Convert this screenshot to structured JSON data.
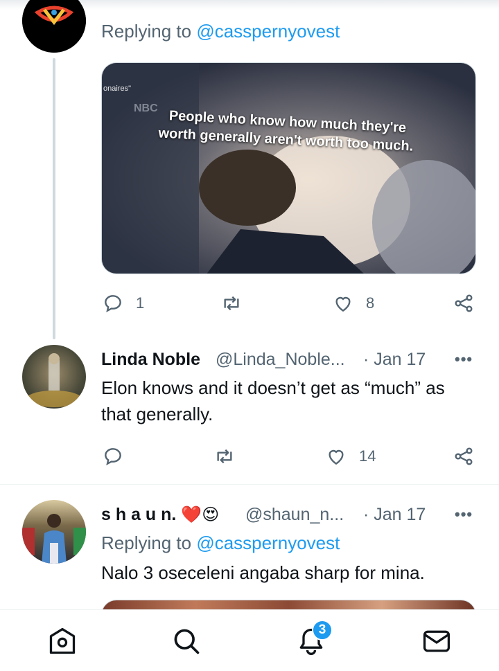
{
  "tweet1": {
    "replying_label": "Replying to",
    "replying_handle": "@casspernyovest",
    "media": {
      "caption_line1": "People who know how much they're",
      "caption_line2": "worth generally aren't worth too much.",
      "corner_text": "onaires\"",
      "bg_text": "NBC"
    },
    "actions": {
      "replies": "1",
      "likes": "8"
    }
  },
  "tweet2": {
    "name": "Linda Noble",
    "handle": "@Linda_Noble...",
    "date": "· Jan 17",
    "text_line1": "Elon knows and it doesn’t get as “much” as",
    "text_line2": "that generally.",
    "actions": {
      "replies": "",
      "likes": "14"
    }
  },
  "tweet3": {
    "name": "s h a u n.",
    "emojis": "❤️😍",
    "handle": "@shaun_n...",
    "date": "· Jan 17",
    "replying_label": "Replying to",
    "replying_handle": "@casspernyovest",
    "text": "Nalo 3 oseceleni angaba sharp for mina."
  },
  "nav": {
    "icons": [
      "home-icon",
      "search-icon",
      "notifications-icon",
      "messages-icon"
    ],
    "notification_count": "3"
  },
  "colors": {
    "accent": "#1d9bf0",
    "muted": "#536471",
    "heart": "#f91880"
  },
  "more_label": "•••"
}
